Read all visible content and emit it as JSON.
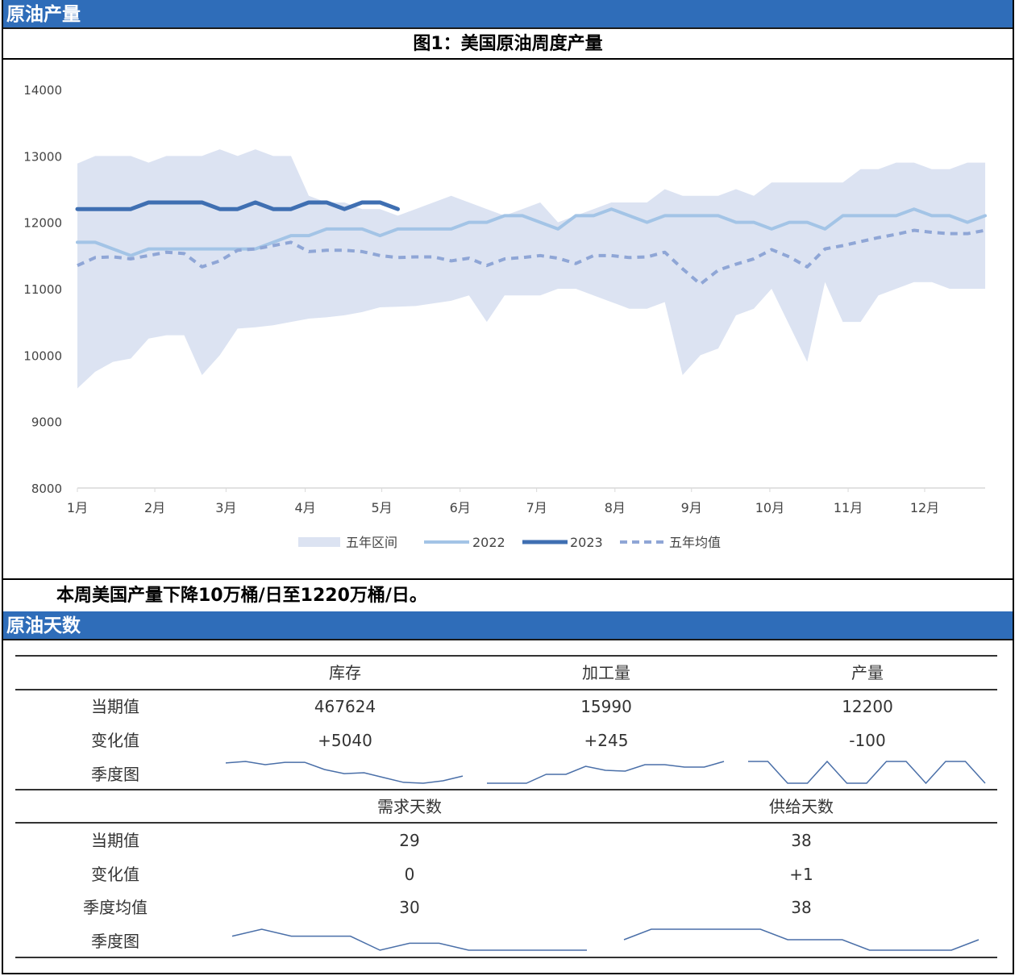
{
  "section1": {
    "title": "原油产量"
  },
  "figure": {
    "title": "图1：美国原油周度产量"
  },
  "summary": "本周美国产量下降10万桶/日至1220万桶/日。",
  "section2": {
    "title": "原油天数"
  },
  "chart_data": {
    "type": "line",
    "title": "图1：美国原油周度产量",
    "xlabel": "",
    "ylabel": "",
    "ylim": [
      8000,
      14000
    ],
    "yticks": [
      8000,
      9000,
      10000,
      11000,
      12000,
      13000,
      14000
    ],
    "ytick_labels": [
      "8000",
      "9000",
      "10000",
      "11000",
      "12000",
      "13000",
      "14000"
    ],
    "xticks_week": [
      0,
      4.35,
      8.35,
      12.8,
      17.1,
      21.5,
      25.8,
      30.2,
      34.5,
      38.9,
      43.3,
      47.6
    ],
    "xtick_labels": [
      "1月",
      "2月",
      "3月",
      "4月",
      "5月",
      "6月",
      "7月",
      "8月",
      "9月",
      "10月",
      "11月",
      "12月"
    ],
    "weeks": 52,
    "legend_position": "bottom",
    "colors": {
      "band": "#DCE3F2",
      "s2022": "#A3C4E6",
      "s2023": "#3F6FB2",
      "avg": "#8FA6D6"
    },
    "band": {
      "name": "五年区间",
      "upper": [
        12885,
        13000,
        13000,
        13000,
        12900,
        13000,
        13000,
        13000,
        13100,
        13000,
        13100,
        13000,
        13000,
        12400,
        12300,
        12300,
        12200,
        12200,
        12100,
        12200,
        12300,
        12400,
        12300,
        12200,
        12100,
        12200,
        12300,
        12000,
        12100,
        12200,
        12300,
        12300,
        12300,
        12500,
        12400,
        12400,
        12400,
        12500,
        12400,
        12600,
        12600,
        12600,
        12600,
        12600,
        12800,
        12800,
        12900,
        12900,
        12800,
        12800,
        12900,
        12900
      ],
      "lower": [
        9500,
        9750,
        9900,
        9950,
        10250,
        10300,
        10300,
        9700,
        10000,
        10400,
        10420,
        10450,
        10500,
        10550,
        10570,
        10600,
        10650,
        10720,
        10730,
        10740,
        10780,
        10820,
        10900,
        10500,
        10900,
        10900,
        10900,
        11000,
        11000,
        10900,
        10800,
        10700,
        10700,
        10800,
        9700,
        10000,
        10100,
        10600,
        10700,
        11000,
        10450,
        9900,
        11100,
        10500,
        10500,
        10900,
        11000,
        11100,
        11100,
        11000,
        11000,
        11000
      ]
    },
    "series": [
      {
        "name": "2022",
        "values": [
          11700,
          11700,
          11600,
          11500,
          11600,
          11600,
          11600,
          11600,
          11600,
          11600,
          11600,
          11700,
          11800,
          11800,
          11900,
          11900,
          11900,
          11800,
          11900,
          11900,
          11900,
          11900,
          12000,
          12000,
          12100,
          12100,
          12000,
          11900,
          12100,
          12100,
          12200,
          12100,
          12000,
          12100,
          12100,
          12100,
          12100,
          12000,
          12000,
          11900,
          12000,
          12000,
          11900,
          12100,
          12100,
          12100,
          12100,
          12200,
          12100,
          12100,
          12000,
          12100
        ]
      },
      {
        "name": "2023",
        "values": [
          12200,
          12200,
          12200,
          12200,
          12300,
          12300,
          12300,
          12300,
          12200,
          12200,
          12300,
          12200,
          12200,
          12300,
          12300,
          12200,
          12300,
          12300,
          12200
        ]
      },
      {
        "name": "五年均值",
        "values": [
          11350,
          11470,
          11480,
          11450,
          11500,
          11550,
          11530,
          11330,
          11420,
          11580,
          11600,
          11650,
          11700,
          11560,
          11580,
          11580,
          11560,
          11500,
          11470,
          11480,
          11480,
          11420,
          11460,
          11350,
          11450,
          11470,
          11500,
          11460,
          11380,
          11500,
          11500,
          11470,
          11480,
          11550,
          11300,
          11070,
          11280,
          11370,
          11450,
          11590,
          11480,
          11330,
          11600,
          11650,
          11710,
          11770,
          11820,
          11880,
          11850,
          11830,
          11830,
          11880
        ]
      }
    ]
  },
  "table1": {
    "headers": [
      "库存",
      "加工量",
      "产量"
    ],
    "rows": [
      {
        "label": "当期值",
        "values": [
          "467624",
          "15990",
          "12200"
        ]
      },
      {
        "label": "变化值",
        "values": [
          "+5040",
          "+245",
          "-100"
        ]
      }
    ],
    "spark_label": "季度图",
    "sparklines": [
      [
        9.3,
        10,
        8.5,
        9.6,
        9.6,
        6.3,
        4.4,
        4.8,
        2.6,
        0.4,
        0,
        1.1,
        3.3
      ],
      [
        0,
        0,
        0,
        11,
        11,
        21,
        16,
        15,
        23,
        23,
        20,
        20,
        27
      ],
      [
        12300,
        12300,
        12200,
        12200,
        12300,
        12200,
        12200,
        12300,
        12300,
        12200,
        12300,
        12300,
        12200
      ]
    ]
  },
  "table2": {
    "headers": [
      "需求天数",
      "供给天数"
    ],
    "rows": [
      {
        "label": "当期值",
        "values": [
          "29",
          "38"
        ]
      },
      {
        "label": "变化值",
        "values": [
          "0",
          "+1"
        ]
      },
      {
        "label": "季度均值",
        "values": [
          "30",
          "38"
        ]
      }
    ],
    "spark_label": "季度图",
    "sparklines": [
      [
        30,
        31,
        30,
        30,
        30,
        28,
        29,
        29,
        28,
        28,
        28,
        28,
        28
      ],
      [
        37,
        38,
        38,
        38,
        38,
        38,
        37,
        37,
        37,
        36,
        36,
        36,
        36,
        37
      ]
    ],
    "spark_color": "#4A6FA8"
  }
}
